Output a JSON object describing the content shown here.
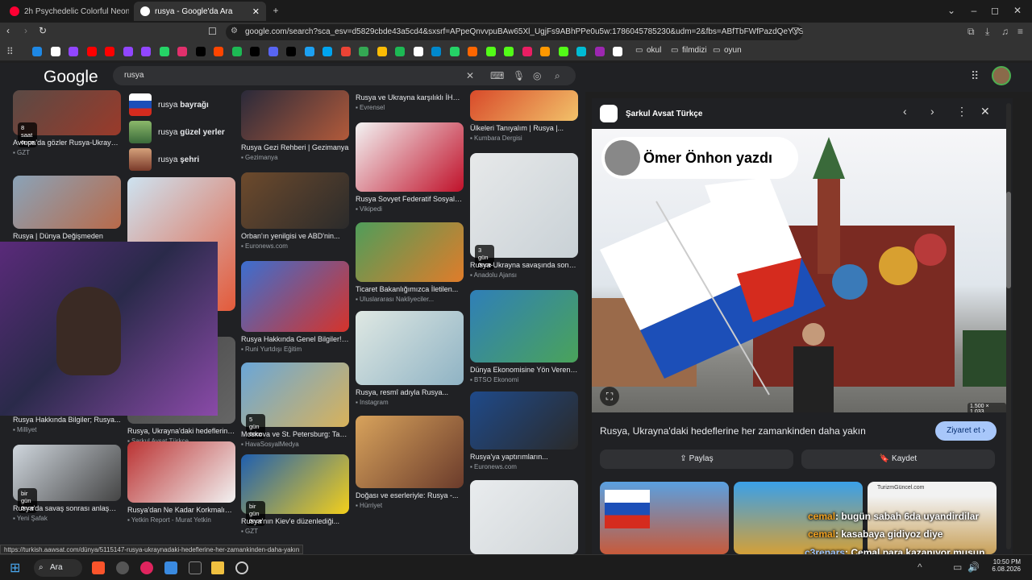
{
  "tabs": [
    {
      "title": "2h Psychedelic Colorful Neon Backgr",
      "color": "#ff0033"
    },
    {
      "title": "rusya - Google'da Ara",
      "color": "#ffffff"
    }
  ],
  "window_controls": {
    "new_tab": "+",
    "dropdown": "⌄",
    "minimize": "–",
    "maximize": "◻",
    "close": "✕"
  },
  "address": {
    "url": "google.com/search?sca_esv=d5829cbde43a5cd4&sxsrf=APpeQnvvpuBAw65Xl_UgjFs9ABhPPe0u5w:1786045785230&udm=2&fbs=ABfTbFWfPazdQeYYSro3Hg..."
  },
  "bookmarks": {
    "folders": [
      {
        "label": "okul"
      },
      {
        "label": "filmdizi"
      },
      {
        "label": "oyun"
      }
    ],
    "icons": [
      "#1e88e5",
      "#fff",
      "#9146ff",
      "#ff0000",
      "#ff0000",
      "#9146ff",
      "#9146ff",
      "#25d366",
      "#e1306c",
      "#000",
      "#ff4500",
      "#1db954",
      "#000",
      "#5865f2",
      "#000",
      "#1da1f2",
      "#00a4ef",
      "#ea4335",
      "#34a853",
      "#fbbc05",
      "#1db954",
      "#fff",
      "#0088cc",
      "#25d366",
      "#ff6600",
      "#53fc18",
      "#53fc18",
      "#e91e63",
      "#ff9800",
      "#53fc18",
      "#00bcd4",
      "#9c27b0",
      "#fff"
    ]
  },
  "google": {
    "logo": "Google",
    "query": "rusya"
  },
  "related": [
    {
      "label": "rusya ",
      "bold": "bayrağı"
    },
    {
      "label": "rusya ",
      "bold": "güzel yerler"
    },
    {
      "label": "rusya ",
      "bold": "şehri"
    }
  ],
  "results": [
    {
      "caption": "Avrupa'da gözler Rusya-Ukrayna...",
      "source": "GZT",
      "badge": "8 saat önce",
      "c1": "#5a4a45",
      "c2": "#9a3a2a"
    },
    {
      "caption": "Rusya | Dünya Değişmeden",
      "source": "",
      "c1": "#8aa3b8",
      "c2": "#b86a4a"
    },
    {
      "caption": "Rusya Hakkında Bilgiler; Rusya...",
      "source": "Milliyet",
      "c1": "#556",
      "c2": "#334"
    },
    {
      "caption": "Rusya'da savaş sonrası anlaşmal...",
      "source": "Yeni Şafak",
      "badge": "bir gün önce",
      "c1": "#cfd6dd",
      "c2": "#444"
    },
    {
      "caption": "",
      "source": "",
      "c1": "#cde3f1",
      "c2": "#e35a3a"
    },
    {
      "caption": "Rusya, Ukrayna'daki hedeflerine...",
      "source": "Şarkul Avsat Türkçe",
      "c1": "#444",
      "c2": "#666"
    },
    {
      "caption": "Rusya'dan Ne Kadar Korkmalıyız...",
      "source": "Yetkin Report - Murat Yetkin",
      "c1": "#b33",
      "c2": "#f2f2f2"
    },
    {
      "caption": "Rusya Gezi Rehberi | Gezimanya",
      "source": "Gezimanya",
      "c1": "#2a2a3a",
      "c2": "#b25a3a"
    },
    {
      "caption": "Orban'ın yenilgisi ve ABD'nin...",
      "source": "Euronews.com",
      "c1": "#6d4a2c",
      "c2": "#2b2b2b"
    },
    {
      "caption": "Rusya Hakkında Genel Bilgiler! -...",
      "source": "Runi Yurtdışı Eğitim",
      "c1": "#3b6fd1",
      "c2": "#d6332a"
    },
    {
      "caption": "Moskova ve St. Petersburg: Tarih...",
      "source": "HavaSosyalMedya",
      "badge": "5 gün önce",
      "c1": "#6aa6d8",
      "c2": "#d8b25a"
    },
    {
      "caption": "Rusya'nın Kiev'e düzenlediği...",
      "source": "GZT",
      "badge": "bir gün önce",
      "c1": "#1f5fb0",
      "c2": "#f3cf1b"
    },
    {
      "caption": "Rusya ve Ukrayna karşılıklı İHA...",
      "source": "Evrensel",
      "c1": "#334",
      "c2": "#556"
    },
    {
      "caption": "Rusya Sovyet Federatif Sosyalist...",
      "source": "Vikipedi",
      "c1": "#f3f3f3",
      "c2": "#c0112a"
    },
    {
      "caption": "Ticaret Bakanlığımızca İletilen...",
      "source": "Uluslararası Nakliyeciler...",
      "c1": "#4f9d5a",
      "c2": "#e07c2a"
    },
    {
      "caption": "Rusya, resmî adıyla Rusya...",
      "source": "Instagram",
      "c1": "#dfe8e3",
      "c2": "#8fb3c4"
    },
    {
      "caption": "Doğası ve eserleriyle: Rusya -...",
      "source": "Hürriyet",
      "c1": "#d8a35c",
      "c2": "#6b3b2b"
    },
    {
      "caption": "Ülkeleri Tanıyalım | Rusya |...",
      "source": "Kumbara Dergisi",
      "c1": "#d84a2a",
      "c2": "#f2c26a"
    },
    {
      "caption": "Rusya-Ukrayna savaşında son 24...",
      "source": "Anadolu Ajansı",
      "badge": "3 gün önce",
      "c1": "#e7e9ea",
      "c2": "#c9d1d6"
    },
    {
      "caption": "Dünya Ekonomisine Yön Veren Ül...",
      "source": "BTSO Ekonomi",
      "c1": "#2f7fb8",
      "c2": "#4aa35a"
    },
    {
      "caption": "Rusya'ya yaptırımların...",
      "source": "Euronews.com",
      "c1": "#1f4a8a",
      "c2": "#2a2a2a"
    },
    {
      "caption": "",
      "source": "",
      "c1": "#e9ecee",
      "c2": "#d0d5d8"
    }
  ],
  "panel": {
    "source": "Şarkul Avsat Türkçe",
    "overlay": "Ömer Önhon yazdı",
    "size": "1.500 × 1.033",
    "title": "Rusya, Ukrayna'daki hedeflerine her zamankinden daha yakın",
    "visit": "Ziyaret et",
    "share": "Paylaş",
    "save": "Kaydet",
    "thumb3_label": "TurizmGüncel.com"
  },
  "chat": [
    {
      "user": "cemal",
      "text": ": bugün sabah 6da uyandirdilar",
      "color": "#f0a020"
    },
    {
      "user": "cemal",
      "text": ": kasabaya gidiyoz diye",
      "color": "#f0a020"
    },
    {
      "user": "c3renars",
      "text": ": Cemal para kazanıyor musun",
      "color": "#9ec4ff"
    },
    {
      "user": "cemal",
      "text": ": akşam 5e kadar",
      "color": "#f0a020"
    }
  ],
  "statusbar": "https://turkish.aawsat.com/dünya/5115147-rusya-ukraynadaki-hedeflerine-her-zamankinden-daha-yakın",
  "taskbar": {
    "search": "Ara",
    "time": "10:50 PM",
    "date": "6.08.2026"
  }
}
